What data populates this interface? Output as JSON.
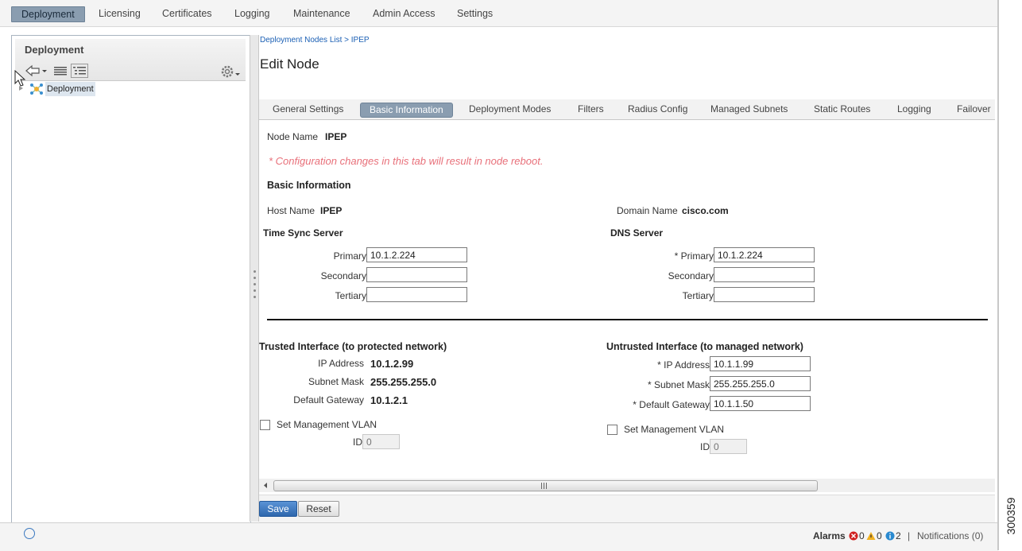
{
  "top_nav": {
    "items": [
      "Deployment",
      "Licensing",
      "Certificates",
      "Logging",
      "Maintenance",
      "Admin Access",
      "Settings"
    ],
    "active": "Deployment"
  },
  "left_panel": {
    "title": "Deployment",
    "tree_root": "Deployment"
  },
  "breadcrumb": "Deployment Nodes List > IPEP",
  "page_title": "Edit Node",
  "tabs": [
    "General Settings",
    "Basic Information",
    "Deployment Modes",
    "Filters",
    "Radius Config",
    "Managed Subnets",
    "Static Routes",
    "Logging",
    "Failover"
  ],
  "active_tab": "Basic Information",
  "form": {
    "node_name_label": "Node Name",
    "node_name": "IPEP",
    "reboot_warning": "* Configuration changes in this tab will result in node reboot.",
    "section_title": "Basic Information",
    "host_name_label": "Host Name",
    "host_name": "IPEP",
    "domain_name_label": "Domain Name",
    "domain_name": "cisco.com",
    "time_sync": {
      "title": "Time Sync Server",
      "primary_label": "Primary",
      "primary": "10.1.2.224",
      "secondary_label": "Secondary",
      "secondary": "",
      "tertiary_label": "Tertiary",
      "tertiary": ""
    },
    "dns": {
      "title": "DNS Server",
      "primary_label": "* Primary",
      "primary": "10.1.2.224",
      "secondary_label": "Secondary",
      "secondary": "",
      "tertiary_label": "Tertiary",
      "tertiary": ""
    },
    "trusted": {
      "title": "Trusted Interface (to protected network)",
      "ip_label": "IP Address",
      "ip": "10.1.2.99",
      "mask_label": "Subnet Mask",
      "mask": "255.255.255.0",
      "gw_label": "Default Gateway",
      "gw": "10.1.2.1",
      "vlan_label": "Set Management VLAN",
      "id_label": "ID",
      "id_placeholder": "0"
    },
    "untrusted": {
      "title": "Untrusted Interface (to managed network)",
      "ip_label": "* IP Address",
      "ip": "10.1.1.99",
      "mask_label": "* Subnet Mask",
      "mask": "255.255.255.0",
      "gw_label": "* Default Gateway",
      "gw": "10.1.1.50",
      "vlan_label": "Set Management VLAN",
      "id_label": "ID",
      "id_placeholder": "0"
    }
  },
  "buttons": {
    "save": "Save",
    "reset": "Reset"
  },
  "status_bar": {
    "alarms_label": "Alarms",
    "critical_count": "0",
    "warning_count": "0",
    "info_count": "2",
    "separator": "|",
    "notifications": "Notifications (0)"
  },
  "figure_number": "300359",
  "colors": {
    "accent": "#8a9db0",
    "warning_text": "#e8707a",
    "save_button": "#3a78c0",
    "link": "#1a5fb4"
  }
}
